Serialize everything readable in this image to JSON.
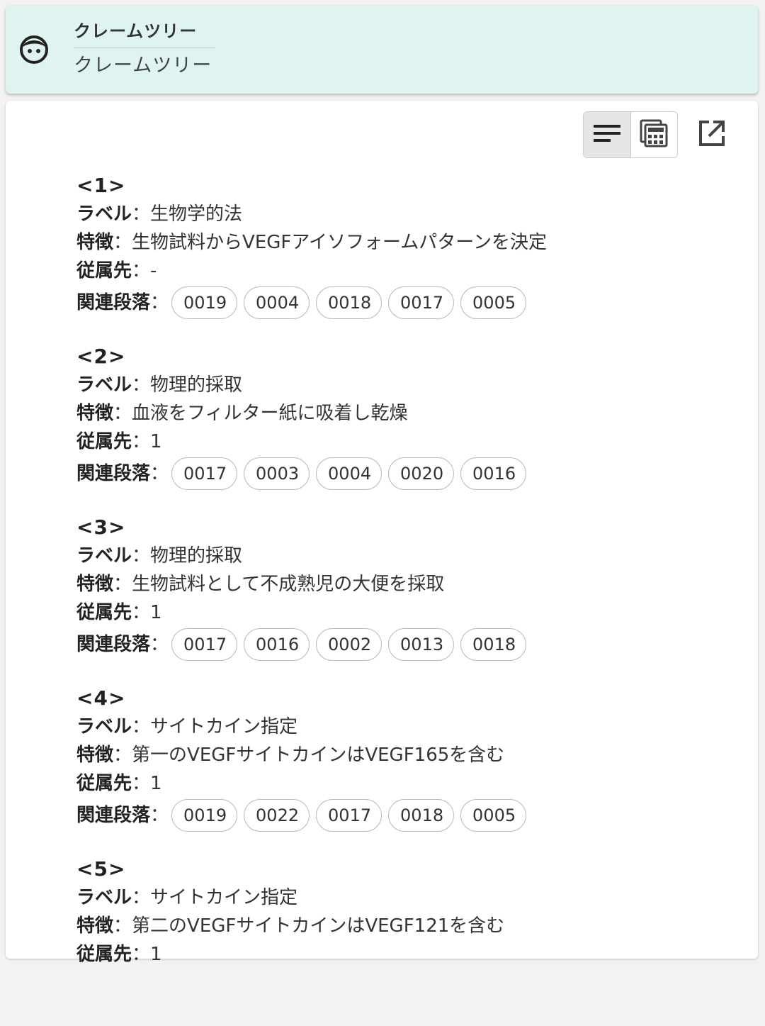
{
  "header": {
    "title": "クレームツリー",
    "subtitle": "クレームツリー",
    "icon": "face-icon"
  },
  "toolbar": {
    "list_view_icon": "list-lines-icon",
    "table_view_icon": "calculator-grid-icon",
    "open_icon": "open-in-new-icon"
  },
  "labels": {
    "label_key": "ラベル",
    "feature_key": "特徴",
    "parent_key": "従属先",
    "paragraph_key": "関連段落",
    "separator": "："
  },
  "claims": [
    {
      "number": "<1>",
      "label": "生物学的法",
      "feature": "生物試料からVEGFアイソフォームパターンを決定",
      "parent": "-",
      "paragraphs": [
        "0019",
        "0004",
        "0018",
        "0017",
        "0005"
      ]
    },
    {
      "number": "<2>",
      "label": "物理的採取",
      "feature": "血液をフィルター紙に吸着し乾燥",
      "parent": "1",
      "paragraphs": [
        "0017",
        "0003",
        "0004",
        "0020",
        "0016"
      ]
    },
    {
      "number": "<3>",
      "label": "物理的採取",
      "feature": "生物試料として不成熟児の大便を採取",
      "parent": "1",
      "paragraphs": [
        "0017",
        "0016",
        "0002",
        "0013",
        "0018"
      ]
    },
    {
      "number": "<4>",
      "label": "サイトカイン指定",
      "feature": "第一のVEGFサイトカインはVEGF165を含む",
      "parent": "1",
      "paragraphs": [
        "0019",
        "0022",
        "0017",
        "0018",
        "0005"
      ]
    },
    {
      "number": "<5>",
      "label": "サイトカイン指定",
      "feature": "第二のVEGFサイトカインはVEGF121を含む",
      "parent": "1",
      "paragraphs": []
    }
  ]
}
